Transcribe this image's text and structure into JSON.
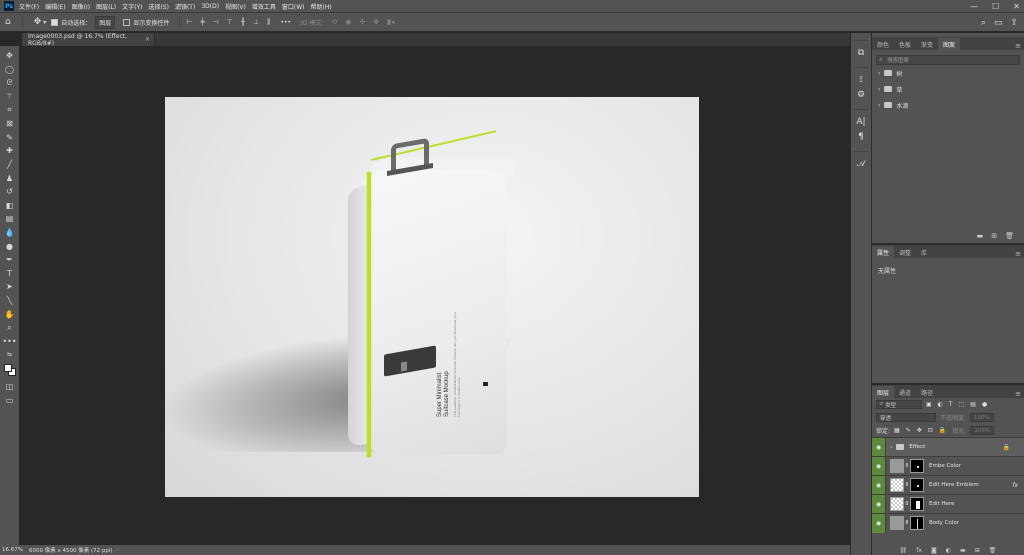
{
  "app": {
    "logo": "Ps",
    "menu": [
      "文件(F)",
      "编辑(E)",
      "图像(I)",
      "图层(L)",
      "文字(Y)",
      "选择(S)",
      "滤镜(T)",
      "3D(D)",
      "视图(V)",
      "增效工具",
      "窗口(W)",
      "帮助(H)"
    ],
    "window_controls": {
      "minimize": "—",
      "maximize": "☐",
      "close": "✕"
    }
  },
  "options": {
    "auto_select_label": "自动选择：",
    "auto_select_value": "图层",
    "show_transform_label": "显示变换控件",
    "more": "•••",
    "mode3d": "3D 模式："
  },
  "document": {
    "tab_title": "Image0003.psd @ 16.7% (Effect, RGB/8#)",
    "tab_close": "×",
    "zoom": "16.67%",
    "size_info": "6000 像素 x 4500 像素 (72 ppi)",
    "status_arrow": "›"
  },
  "product": {
    "title": "Super Minimalist\nSuitcase Mockup",
    "body": "This powerful, photorealistic Suitcase mockup lets you showcase your branding in a modern way."
  },
  "panels": {
    "libraries": {
      "tabs": [
        "颜色",
        "色板",
        "渐变",
        "图案"
      ],
      "active_tab": 3,
      "search_placeholder": "搜索图案",
      "folders": [
        "树",
        "草",
        "水滴"
      ]
    },
    "properties": {
      "tabs": [
        "属性",
        "调整",
        "库"
      ],
      "active_tab": 0,
      "empty": "无属性"
    },
    "layers": {
      "tabs": [
        "图层",
        "通道",
        "路径"
      ],
      "active_tab": 0,
      "kind": "类型",
      "blend_mode": "穿透",
      "opacity_label": "不透明度:",
      "opacity_value": "100%",
      "lock_label": "锁定:",
      "fill_label": "填充:",
      "fill_value": "100%",
      "items": [
        {
          "name": "Effect",
          "type": "group",
          "locked": true
        },
        {
          "name": "Embe Color",
          "type": "layer",
          "thumb": "gray",
          "fx": false
        },
        {
          "name": "Edit Here Emblem",
          "type": "layer",
          "thumb": "check",
          "fx": true
        },
        {
          "name": "Edit Here",
          "type": "layer",
          "thumb": "check",
          "fx": false
        },
        {
          "name": "Body Color",
          "type": "layer",
          "thumb": "gray",
          "fx": false
        }
      ]
    }
  },
  "colors": {
    "accent_green": "#b8e02a",
    "visibility_green": "#5b8a3c",
    "ui_gray": "#535353"
  }
}
